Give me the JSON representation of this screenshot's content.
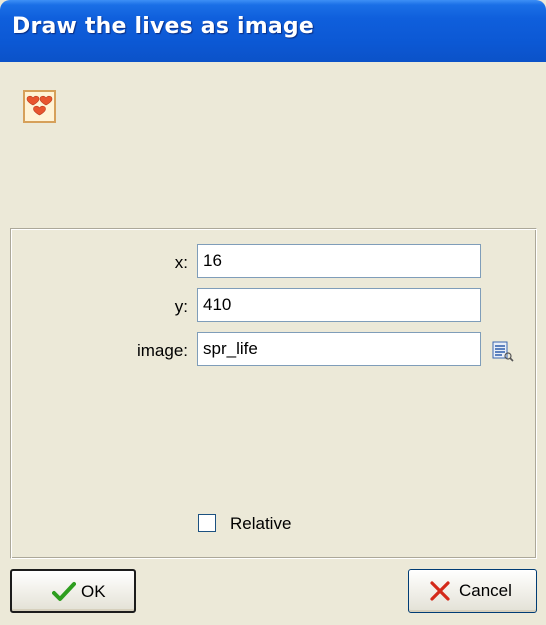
{
  "window": {
    "title": "Draw the lives as image"
  },
  "action": {
    "icon": "hearts-icon"
  },
  "fields": [
    {
      "label": "x:",
      "value": "16"
    },
    {
      "label": "y:",
      "value": "410"
    },
    {
      "label": "image:",
      "value": "spr_life"
    }
  ],
  "image_browse_icon": "sprite-browse-icon",
  "relative": {
    "label": "Relative",
    "checked": false
  },
  "buttons": {
    "ok_label": "OK",
    "cancel_label": "Cancel"
  },
  "colors": {
    "titlebar": "#0c58d4",
    "dialog_bg": "#ece9d8",
    "ok_check": "#2e9e1f",
    "cancel_x": "#d42a1a",
    "heart": "#e8552f"
  }
}
